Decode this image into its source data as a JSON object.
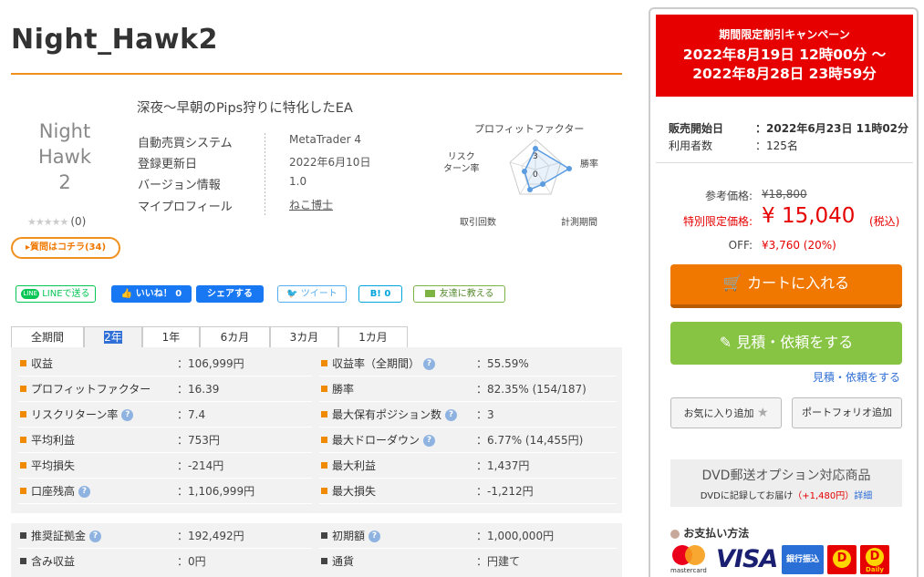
{
  "page": {
    "title": "Night_Hawk2",
    "subtitle": "深夜〜早朝のPips狩りに特化したEA"
  },
  "thumb": {
    "lines": [
      "Night",
      "Hawk",
      "2"
    ],
    "stars": "★★★★★",
    "review_count": "(0)",
    "question_button": "▸質問はコチラ(34)"
  },
  "info": [
    {
      "label": "自動売買システム",
      "value": "MetaTrader 4"
    },
    {
      "label": "登録更新日",
      "value": "2022年6月10日"
    },
    {
      "label": "バージョン情報",
      "value": "1.0"
    },
    {
      "label": "マイプロフィール",
      "value": "ねこ博士"
    }
  ],
  "radar": {
    "title": "プロフィットファクター",
    "axes": [
      "勝率",
      "計測期間",
      "取引回数",
      "リスク\nターン率"
    ],
    "labels": {
      "win": "勝率",
      "period": "計測期間",
      "trades": "取引回数",
      "risk_a": "リスク",
      "risk_b": "ターン率"
    },
    "tick_3": "3",
    "tick_0": "0",
    "values": [
      3,
      3,
      1,
      1,
      1
    ]
  },
  "social": {
    "line": "LINEで送る",
    "like": "いいね！ 0",
    "share": "シェアする",
    "tweet": "ツイート",
    "hatena": "B! 0",
    "friend": "友達に教える"
  },
  "tabs": [
    "全期間",
    "2年",
    "1年",
    "6カ月",
    "3カ月",
    "1カ月"
  ],
  "stats_left": [
    {
      "key": "収益",
      "value": "：106,999円",
      "help": false
    },
    {
      "key": "プロフィットファクター",
      "value": "：16.39",
      "help": false
    },
    {
      "key": "リスクリターン率",
      "value": "：7.4",
      "help": true
    },
    {
      "key": "平均利益",
      "value": "：753円",
      "help": false
    },
    {
      "key": "平均損失",
      "value": "：-214円",
      "help": false
    },
    {
      "key": "口座残高",
      "value": "：1,106,999円",
      "help": true
    }
  ],
  "stats_right": [
    {
      "key": "収益率（全期間）",
      "value": "：55.59%",
      "help": true
    },
    {
      "key": "勝率",
      "value": "：82.35% (154/187)",
      "help": false
    },
    {
      "key": "最大保有ポジション数",
      "value": "：3",
      "help": true
    },
    {
      "key": "最大ドローダウン",
      "value": "：6.77% (14,455円)",
      "help": true
    },
    {
      "key": "最大利益",
      "value": "：1,437円",
      "help": false
    },
    {
      "key": "最大損失",
      "value": "：-1,212円",
      "help": false
    }
  ],
  "stats2_left": [
    {
      "key": "推奨証拠金",
      "value": "：192,492円",
      "help": true
    },
    {
      "key": "含み収益",
      "value": "：0円",
      "help": false
    }
  ],
  "stats2_right": [
    {
      "key": "初期額",
      "value": "：1,000,000円",
      "help": true
    },
    {
      "key": "通貨",
      "value": "：円建て",
      "help": false
    }
  ],
  "help_icon": "?",
  "campaign": {
    "heading": "期間限定割引キャンペーン",
    "line1": "2022年8月19日 12時00分 〜",
    "line2": "2022年8月28日 23時59分"
  },
  "sale_info": {
    "start_label": "販売開始日",
    "start_value": "：2022年6月23日 11時02分",
    "users_label": "利用者数",
    "users_value": "：125名"
  },
  "price": {
    "ref_label": "参考価格:",
    "ref_value": "¥18,800",
    "special_label": "特別限定価格:",
    "special_value": "¥ 15,040",
    "tax": "(税込)",
    "off_label": "OFF:",
    "off_value": "¥3,760 (20%)"
  },
  "buttons": {
    "cart": "カートに入れる",
    "quote": "見積・依頼をする",
    "quote_link": "見積・依頼をする",
    "favorite": "お気に入り追加",
    "portfolio": "ポートフォリオ追加"
  },
  "dvd": {
    "title": "DVD郵送オプション対応商品",
    "desc": "DVDに記録してお届け",
    "price": "（+1,480円）",
    "link": "詳細"
  },
  "payment": {
    "title": "お支払い方法",
    "visa": "VISA",
    "mastercard": "mastercard",
    "bank": "銀行振込",
    "daily_brand": "Daily"
  },
  "colors": {
    "accent": "#f0901a",
    "campaign": "#e60000",
    "cart": "#f07800",
    "quote": "#88c444",
    "price_red": "#e60000"
  }
}
